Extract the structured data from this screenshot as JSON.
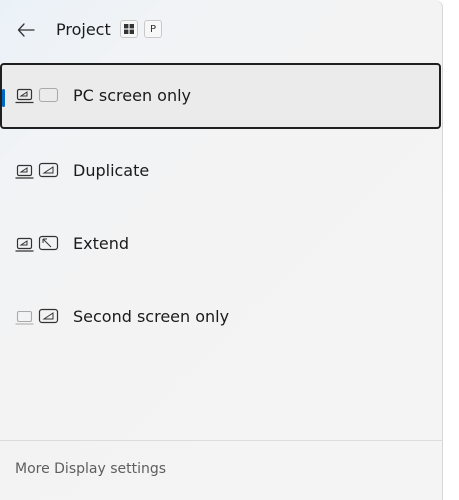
{
  "header": {
    "title": "Project",
    "shortcut": {
      "win_key": "windows-logo-icon",
      "letter_key": "P"
    },
    "back_icon": "arrow-left-icon"
  },
  "options": [
    {
      "label": "PC screen only",
      "icon": "pc-screen-only-icon",
      "selected": true
    },
    {
      "label": "Duplicate",
      "icon": "duplicate-icon",
      "selected": false
    },
    {
      "label": "Extend",
      "icon": "extend-icon",
      "selected": false
    },
    {
      "label": "Second screen only",
      "icon": "second-screen-only-icon",
      "selected": false
    }
  ],
  "footer": {
    "link": "More Display settings"
  },
  "colors": {
    "accent": "#0067c0",
    "text": "#1b1b1b",
    "muted": "#5e5e5e",
    "selected_bg": "#ebebeb"
  }
}
